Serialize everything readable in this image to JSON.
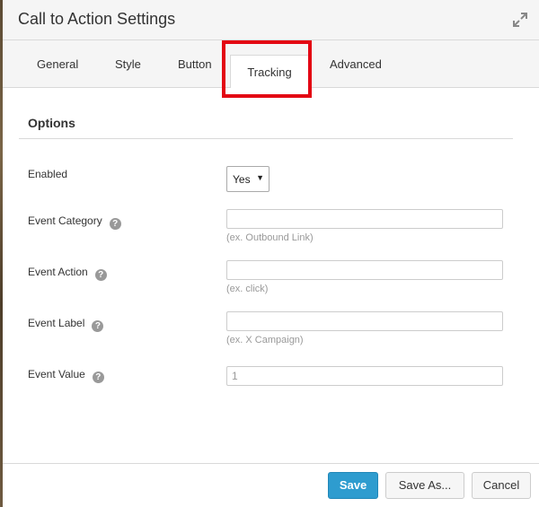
{
  "dialog": {
    "title": "Call to Action Settings"
  },
  "tabs": [
    {
      "label": "General"
    },
    {
      "label": "Style"
    },
    {
      "label": "Button"
    },
    {
      "label": "Tracking"
    },
    {
      "label": "Advanced"
    }
  ],
  "section": {
    "title": "Options"
  },
  "fields": {
    "enabled": {
      "label": "Enabled",
      "value": "Yes"
    },
    "event_category": {
      "label": "Event Category",
      "value": "",
      "hint": "(ex. Outbound Link)"
    },
    "event_action": {
      "label": "Event Action",
      "value": "",
      "hint": "(ex. click)"
    },
    "event_label": {
      "label": "Event Label",
      "value": "",
      "hint": "(ex. X Campaign)"
    },
    "event_value": {
      "label": "Event Value",
      "value": "1"
    }
  },
  "footer": {
    "save": "Save",
    "save_as": "Save As...",
    "cancel": "Cancel"
  },
  "icons": {
    "help": "?",
    "expand": "expand-icon"
  },
  "colors": {
    "primary": "#2e9ccf",
    "highlight": "#e30613"
  }
}
